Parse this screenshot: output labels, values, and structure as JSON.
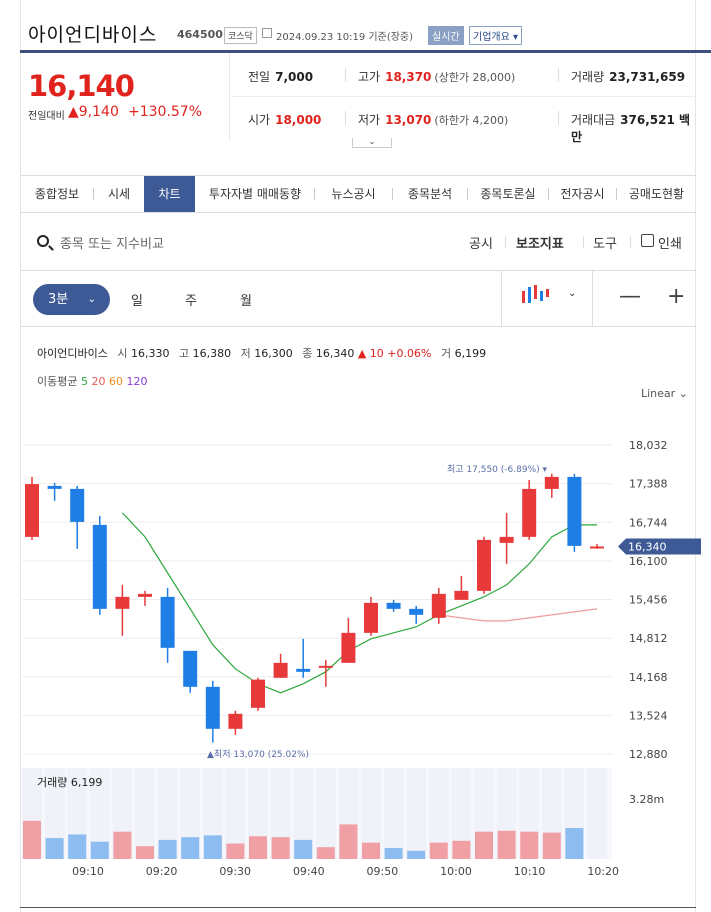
{
  "header": {
    "stock_name": "아이언디바이스",
    "code": "464500",
    "market": "코스닥",
    "timestamp": "2024.09.23 10:19 기준(장중)",
    "realtime_badge": "실시간",
    "company_info_button": "기업개요 ▾"
  },
  "price": {
    "current": "16,140",
    "change_label": "전일대비",
    "change_value": "▲9,140",
    "change_pct": "+130.57%"
  },
  "stats": {
    "prev_close_label": "전일",
    "prev_close": "7,000",
    "high_label": "고가",
    "high": "18,370",
    "high_sub": "(상한가 28,000)",
    "volume_label": "거래량",
    "volume": "23,731,659",
    "open_label": "시가",
    "open": "18,000",
    "low_label": "저가",
    "low": "13,070",
    "low_sub": "(하한가 4,200)",
    "value_label": "거래대금",
    "value": "376,521 백만"
  },
  "tabs": [
    "종합정보",
    "시세",
    "차트",
    "투자자별 매매동향",
    "뉴스공시",
    "종목분석",
    "종목토론실",
    "전자공시",
    "공매도현황"
  ],
  "active_tab": "차트",
  "toolbar": {
    "search_placeholder": "종목 또는 지수비교",
    "disclosure": "공시",
    "indicator": "보조지표",
    "tools": "도구",
    "print": "인쇄"
  },
  "periods": {
    "selected": "3분",
    "items": [
      "일",
      "주",
      "월"
    ],
    "zoom_out": "—",
    "zoom_in": "+"
  },
  "ohlc_bar": {
    "name": "아이언디바이스",
    "open_label": "시",
    "open": "16,330",
    "high_label": "고",
    "high": "16,380",
    "low_label": "저",
    "low": "16,300",
    "close_label": "종",
    "close": "16,340",
    "change": "▲ 10 +0.06%",
    "volume_label": "거",
    "volume": "6,199"
  },
  "moving_average": {
    "label": "이동평균",
    "p5": "5",
    "p20": "20",
    "p60": "60",
    "p120": "120"
  },
  "scale_mode": "Linear ⌄",
  "colors": {
    "up": "#e8393a",
    "down": "#1e7ee6",
    "ma5": "#2ea83d",
    "ma20": "#f09a9a",
    "accent": "#3d5a96"
  },
  "chart_data": {
    "type": "candlestick",
    "yaxis_ticks": [
      "18,032",
      "17,388",
      "16,744",
      "16,100",
      "15,456",
      "14,812",
      "14,168",
      "13,524",
      "12,880"
    ],
    "ylim": [
      12880,
      18032
    ],
    "x_ticks": [
      "09:10",
      "09:20",
      "09:30",
      "09:40",
      "09:50",
      "10:00",
      "10:10",
      "10:20"
    ],
    "last_price_label": "16,340",
    "max_label": "최고 17,550 (-6.89%) ▾",
    "min_label": "▲최저 13,070 (25.02%)",
    "volume_label": "거래량",
    "volume_value": "6,199",
    "volume_axis_label": "3.28m",
    "candles": [
      {
        "o": 16500,
        "h": 17500,
        "l": 16450,
        "c": 17380
      },
      {
        "o": 17350,
        "h": 17400,
        "l": 17100,
        "c": 17300
      },
      {
        "o": 17300,
        "h": 17350,
        "l": 16300,
        "c": 16750
      },
      {
        "o": 16700,
        "h": 16850,
        "l": 15200,
        "c": 15300
      },
      {
        "o": 15300,
        "h": 15700,
        "l": 14850,
        "c": 15500
      },
      {
        "o": 15500,
        "h": 15600,
        "l": 15350,
        "c": 15550
      },
      {
        "o": 15500,
        "h": 15650,
        "l": 14400,
        "c": 14650
      },
      {
        "o": 14600,
        "h": 14600,
        "l": 13900,
        "c": 14000
      },
      {
        "o": 14000,
        "h": 14100,
        "l": 13070,
        "c": 13300
      },
      {
        "o": 13300,
        "h": 13600,
        "l": 13200,
        "c": 13550
      },
      {
        "o": 13650,
        "h": 14150,
        "l": 13600,
        "c": 14120
      },
      {
        "o": 14150,
        "h": 14550,
        "l": 14150,
        "c": 14400
      },
      {
        "o": 14300,
        "h": 14800,
        "l": 14150,
        "c": 14250
      },
      {
        "o": 14350,
        "h": 14450,
        "l": 14000,
        "c": 14350
      },
      {
        "o": 14400,
        "h": 15150,
        "l": 14400,
        "c": 14900
      },
      {
        "o": 14900,
        "h": 15500,
        "l": 14850,
        "c": 15400
      },
      {
        "o": 15400,
        "h": 15450,
        "l": 15250,
        "c": 15300
      },
      {
        "o": 15300,
        "h": 15350,
        "l": 15050,
        "c": 15200
      },
      {
        "o": 15150,
        "h": 15650,
        "l": 15050,
        "c": 15550
      },
      {
        "o": 15450,
        "h": 15850,
        "l": 15450,
        "c": 15600
      },
      {
        "o": 15600,
        "h": 16500,
        "l": 15550,
        "c": 16450
      },
      {
        "o": 16400,
        "h": 16900,
        "l": 16050,
        "c": 16500
      },
      {
        "o": 16500,
        "h": 17450,
        "l": 16450,
        "c": 17300
      },
      {
        "o": 17300,
        "h": 17550,
        "l": 17150,
        "c": 17500
      },
      {
        "o": 17500,
        "h": 17550,
        "l": 16250,
        "c": 16350
      },
      {
        "o": 16330,
        "h": 16380,
        "l": 16300,
        "c": 16340
      }
    ],
    "ma5": [
      null,
      null,
      null,
      null,
      16900,
      16500,
      15900,
      15300,
      14700,
      14300,
      14050,
      13900,
      14050,
      14250,
      14600,
      14800,
      14900,
      15000,
      15200,
      15350,
      15500,
      15700,
      16050,
      16500,
      16700,
      16700
    ],
    "ma20": [
      null,
      null,
      null,
      null,
      null,
      null,
      null,
      null,
      null,
      null,
      null,
      null,
      null,
      null,
      null,
      null,
      null,
      null,
      15200,
      15150,
      15100,
      15100,
      15150,
      15200,
      15250,
      15300
    ],
    "volume_ratio": [
      0.42,
      0.23,
      0.27,
      0.19,
      0.3,
      0.14,
      0.21,
      0.24,
      0.26,
      0.17,
      0.25,
      0.24,
      0.21,
      0.13,
      0.38,
      0.18,
      0.12,
      0.09,
      0.18,
      0.2,
      0.3,
      0.31,
      0.3,
      0.29,
      0.34,
      0.0
    ]
  }
}
